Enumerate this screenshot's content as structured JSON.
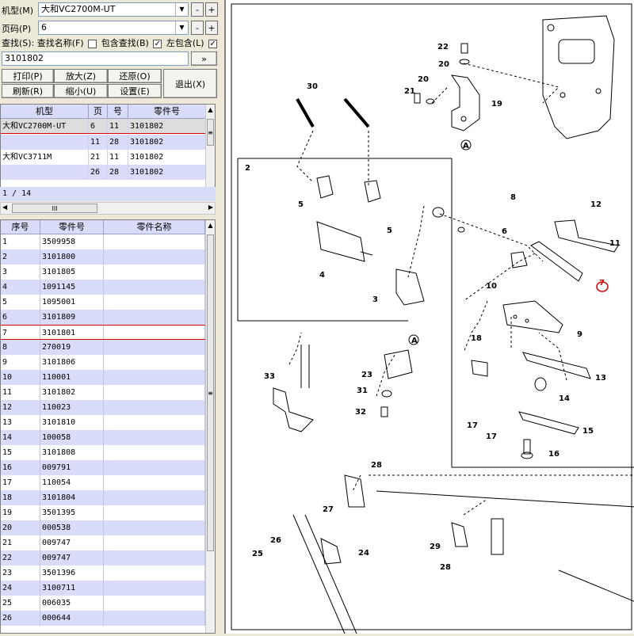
{
  "controls": {
    "model_label": "机型(M)",
    "model_value": "大和VC2700M-UT",
    "page_label": "页码(P)",
    "page_value": "6",
    "find_label": "查找(S):",
    "find_name_label": "查找名称(F)",
    "contain_label": "包含查找(B)",
    "left_contain_label": "左包含(L)",
    "search_value": "3101802",
    "go_label": "»",
    "minus": "-",
    "plus": "+"
  },
  "buttons": {
    "print": "打印(P)",
    "zoom_in": "放大(Z)",
    "restore": "还原(O)",
    "refresh": "刷新(R)",
    "zoom_out": "缩小(U)",
    "settings": "设置(E)",
    "exit": "退出(X)"
  },
  "model_table": {
    "headers": [
      "机型",
      "页",
      "号",
      "零件号"
    ],
    "rows": [
      [
        "大和VC2700M-UT",
        "6",
        "11",
        "3101802"
      ],
      [
        "",
        "11",
        "28",
        "3101802"
      ],
      [
        "大和VC3711M",
        "21",
        "11",
        "3101802"
      ],
      [
        "",
        "26",
        "28",
        "3101802"
      ]
    ],
    "pager": "1 / 14",
    "hscroll_grip": "III"
  },
  "parts_table": {
    "headers": [
      "序号",
      "零件号",
      "零件名称"
    ],
    "rows": [
      [
        "1",
        "3509958"
      ],
      [
        "2",
        "3101800"
      ],
      [
        "3",
        "3101805"
      ],
      [
        "4",
        "1091145"
      ],
      [
        "5",
        "1095001"
      ],
      [
        "6",
        "3101809"
      ],
      [
        "7",
        "3101801"
      ],
      [
        "8",
        "270019"
      ],
      [
        "9",
        "3101806"
      ],
      [
        "10",
        "110001"
      ],
      [
        "11",
        "3101802"
      ],
      [
        "12",
        "110023"
      ],
      [
        "13",
        "3101810"
      ],
      [
        "14",
        "100058"
      ],
      [
        "15",
        "3101808"
      ],
      [
        "16",
        "009791"
      ],
      [
        "17",
        "110054"
      ],
      [
        "18",
        "3101804"
      ],
      [
        "19",
        "3501395"
      ],
      [
        "20",
        "000538"
      ],
      [
        "21",
        "009747"
      ],
      [
        "22",
        "009747"
      ],
      [
        "23",
        "3501396"
      ],
      [
        "24",
        "3100711"
      ],
      [
        "25",
        "006035"
      ],
      [
        "26",
        "000644"
      ]
    ]
  },
  "diagram_labels": [
    "30",
    "22",
    "20",
    "20",
    "21",
    "19",
    "A",
    "2",
    "5",
    "5",
    "4",
    "3",
    "8",
    "12",
    "6",
    "11",
    "10",
    "7",
    "9",
    "A",
    "18",
    "13",
    "23",
    "14",
    "31",
    "32",
    "33",
    "17",
    "17",
    "15",
    "16",
    "28",
    "27",
    "26",
    "25",
    "24",
    "29",
    "28"
  ]
}
